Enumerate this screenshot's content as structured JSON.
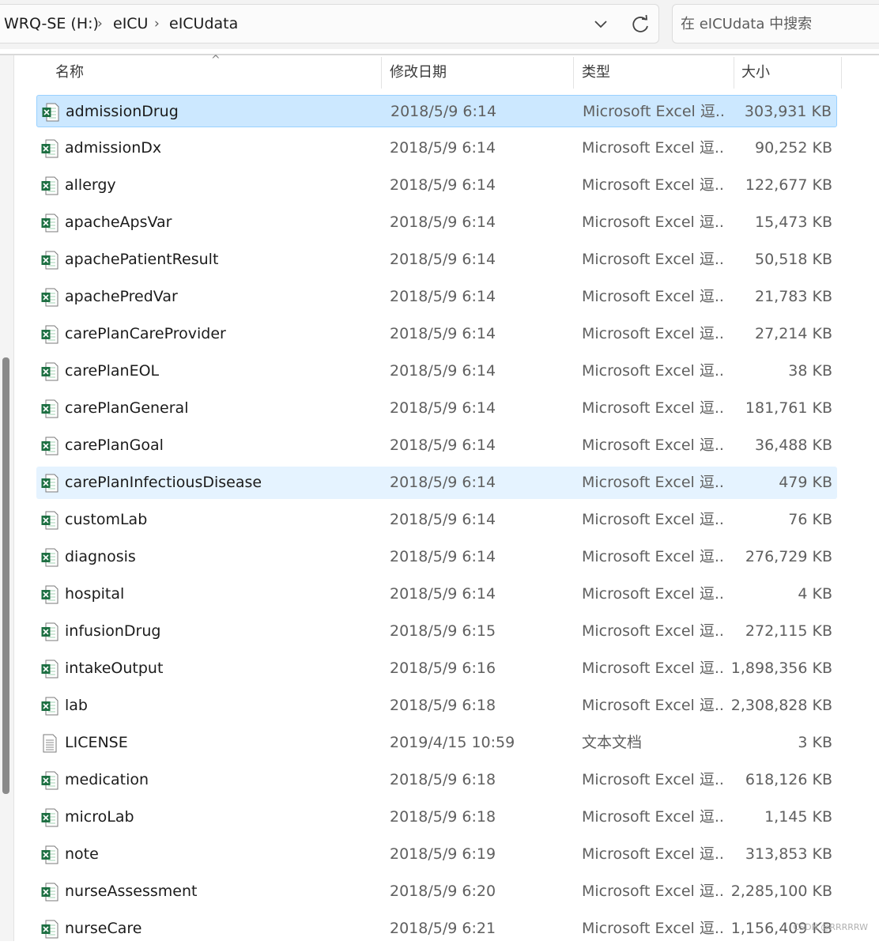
{
  "address_bar": {
    "breadcrumbs": [
      "WRQ-SE (H:)",
      "eICU",
      "eICUdata"
    ],
    "separator": "›"
  },
  "search": {
    "placeholder": "在 eICUdata 中搜索"
  },
  "columns": {
    "name": "名称",
    "date": "修改日期",
    "type": "类型",
    "size": "大小"
  },
  "sort_indicator": "^",
  "files": [
    {
      "name": "admissionDrug",
      "date": "2018/5/9 6:14",
      "type": "Microsoft Excel 逗...",
      "size": "303,931 KB",
      "icon": "excel-icon",
      "state": "selected"
    },
    {
      "name": "admissionDx",
      "date": "2018/5/9 6:14",
      "type": "Microsoft Excel 逗...",
      "size": "90,252 KB",
      "icon": "excel-icon",
      "state": ""
    },
    {
      "name": "allergy",
      "date": "2018/5/9 6:14",
      "type": "Microsoft Excel 逗...",
      "size": "122,677 KB",
      "icon": "excel-icon",
      "state": ""
    },
    {
      "name": "apacheApsVar",
      "date": "2018/5/9 6:14",
      "type": "Microsoft Excel 逗...",
      "size": "15,473 KB",
      "icon": "excel-icon",
      "state": ""
    },
    {
      "name": "apachePatientResult",
      "date": "2018/5/9 6:14",
      "type": "Microsoft Excel 逗...",
      "size": "50,518 KB",
      "icon": "excel-icon",
      "state": ""
    },
    {
      "name": "apachePredVar",
      "date": "2018/5/9 6:14",
      "type": "Microsoft Excel 逗...",
      "size": "21,783 KB",
      "icon": "excel-icon",
      "state": ""
    },
    {
      "name": "carePlanCareProvider",
      "date": "2018/5/9 6:14",
      "type": "Microsoft Excel 逗...",
      "size": "27,214 KB",
      "icon": "excel-icon",
      "state": ""
    },
    {
      "name": "carePlanEOL",
      "date": "2018/5/9 6:14",
      "type": "Microsoft Excel 逗...",
      "size": "38 KB",
      "icon": "excel-icon",
      "state": ""
    },
    {
      "name": "carePlanGeneral",
      "date": "2018/5/9 6:14",
      "type": "Microsoft Excel 逗...",
      "size": "181,761 KB",
      "icon": "excel-icon",
      "state": ""
    },
    {
      "name": "carePlanGoal",
      "date": "2018/5/9 6:14",
      "type": "Microsoft Excel 逗...",
      "size": "36,488 KB",
      "icon": "excel-icon",
      "state": ""
    },
    {
      "name": "carePlanInfectiousDisease",
      "date": "2018/5/9 6:14",
      "type": "Microsoft Excel 逗...",
      "size": "479 KB",
      "icon": "excel-icon",
      "state": "hover"
    },
    {
      "name": "customLab",
      "date": "2018/5/9 6:14",
      "type": "Microsoft Excel 逗...",
      "size": "76 KB",
      "icon": "excel-icon",
      "state": ""
    },
    {
      "name": "diagnosis",
      "date": "2018/5/9 6:14",
      "type": "Microsoft Excel 逗...",
      "size": "276,729 KB",
      "icon": "excel-icon",
      "state": ""
    },
    {
      "name": "hospital",
      "date": "2018/5/9 6:14",
      "type": "Microsoft Excel 逗...",
      "size": "4 KB",
      "icon": "excel-icon",
      "state": ""
    },
    {
      "name": "infusionDrug",
      "date": "2018/5/9 6:15",
      "type": "Microsoft Excel 逗...",
      "size": "272,115 KB",
      "icon": "excel-icon",
      "state": ""
    },
    {
      "name": "intakeOutput",
      "date": "2018/5/9 6:16",
      "type": "Microsoft Excel 逗...",
      "size": "1,898,356 KB",
      "icon": "excel-icon",
      "state": ""
    },
    {
      "name": "lab",
      "date": "2018/5/9 6:18",
      "type": "Microsoft Excel 逗...",
      "size": "2,308,828 KB",
      "icon": "excel-icon",
      "state": ""
    },
    {
      "name": "LICENSE",
      "date": "2019/4/15 10:59",
      "type": "文本文档",
      "size": "3 KB",
      "icon": "text-file-icon",
      "state": ""
    },
    {
      "name": "medication",
      "date": "2018/5/9 6:18",
      "type": "Microsoft Excel 逗...",
      "size": "618,126 KB",
      "icon": "excel-icon",
      "state": ""
    },
    {
      "name": "microLab",
      "date": "2018/5/9 6:18",
      "type": "Microsoft Excel 逗...",
      "size": "1,145 KB",
      "icon": "excel-icon",
      "state": ""
    },
    {
      "name": "note",
      "date": "2018/5/9 6:19",
      "type": "Microsoft Excel 逗...",
      "size": "313,853 KB",
      "icon": "excel-icon",
      "state": ""
    },
    {
      "name": "nurseAssessment",
      "date": "2018/5/9 6:20",
      "type": "Microsoft Excel 逗...",
      "size": "2,285,100 KB",
      "icon": "excel-icon",
      "state": ""
    },
    {
      "name": "nurseCare",
      "date": "2018/5/9 6:21",
      "type": "Microsoft Excel 逗...",
      "size": "1,156,409 KB",
      "icon": "excel-icon",
      "state": ""
    }
  ],
  "watermark": "CSDN @RRRRRW",
  "colors": {
    "selected_bg": "#cce8ff",
    "selected_border": "#99d1ff",
    "hover_bg": "#e5f3ff",
    "excel_green": "#1d6f42"
  }
}
